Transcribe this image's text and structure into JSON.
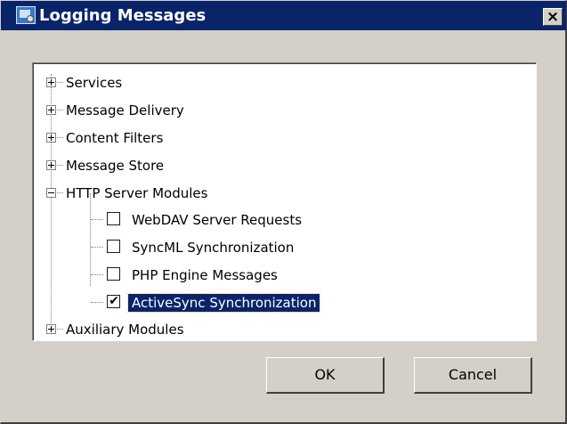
{
  "window": {
    "title": "Logging Messages",
    "close_glyph": "×",
    "icon": "app-settings-icon"
  },
  "tree": {
    "items": [
      {
        "label": "Services",
        "expanded": false
      },
      {
        "label": "Message Delivery",
        "expanded": false
      },
      {
        "label": "Content Filters",
        "expanded": false
      },
      {
        "label": "Message Store",
        "expanded": false
      },
      {
        "label": "HTTP Server Modules",
        "expanded": true,
        "children": [
          {
            "label": "WebDAV Server Requests",
            "checked": false
          },
          {
            "label": "SyncML Synchronization",
            "checked": false
          },
          {
            "label": "PHP Engine Messages",
            "checked": false
          },
          {
            "label": "ActiveSync Synchronization",
            "checked": true,
            "selected": true
          }
        ]
      },
      {
        "label": "Auxiliary Modules",
        "expanded": false
      }
    ],
    "check_glyph": "✔"
  },
  "buttons": {
    "ok_label": "OK",
    "cancel_label": "Cancel"
  },
  "colors": {
    "title_bar": "#0a246a",
    "dialog_face": "#d4d0c8",
    "selection": "#0a246a"
  }
}
